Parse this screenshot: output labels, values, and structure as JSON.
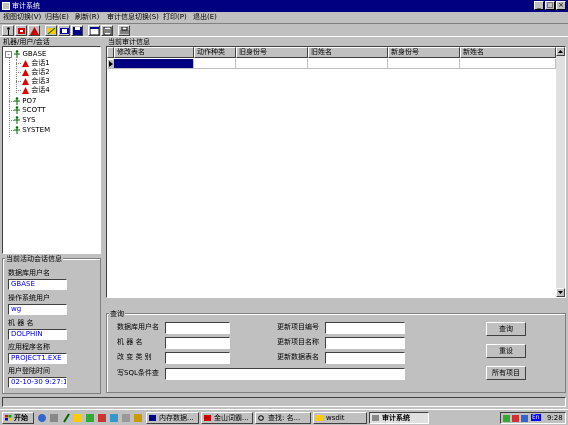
{
  "window": {
    "title": "审计系统"
  },
  "menu": [
    "视图切换(V)",
    "归档(E)",
    "刷新(R)",
    "审计信息切换(S)",
    "打印(P)",
    "退出(E)"
  ],
  "tree": {
    "title": "机器/用户/会话",
    "root": "GBASE",
    "sessions": [
      "会话1",
      "会话2",
      "会话3",
      "会话4"
    ],
    "users": [
      "PO7",
      "SCOTT",
      "SYS",
      "SYSTEM"
    ]
  },
  "session_info": {
    "title": "当前活动会话信息",
    "fields": [
      {
        "label": "数据库用户名",
        "value": "GBASE"
      },
      {
        "label": "操作系统用户",
        "value": "wg"
      },
      {
        "label": "机 器 名",
        "value": "DOLPHIN"
      },
      {
        "label": "应用程序名称",
        "value": "PROJECT1.EXE"
      },
      {
        "label": "用户登陆时间",
        "value": "02-10-30 9:27:10"
      }
    ]
  },
  "audit": {
    "title": "当前审计信息",
    "columns": [
      "修改表名",
      "动作种类",
      "旧身份号",
      "旧姓名",
      "新身份号",
      "新姓名"
    ]
  },
  "query": {
    "title": "查询",
    "labels": {
      "db_user": "数据库用户名",
      "machine": "机 器 名",
      "change_type": "改 变 类 别",
      "update_no": "更新项目编号",
      "update_name": "更新项目名称",
      "update_table": "更新数据表名",
      "sql": "写SQL条件查"
    },
    "buttons": {
      "query": "查询",
      "reset": "重设",
      "all": "所有项目"
    }
  },
  "taskbar": {
    "start": "开始",
    "tasks": [
      "内存数据...",
      "金山词霸...",
      "查找: 名...",
      "wsdit",
      "审计系统"
    ],
    "time": "9:28",
    "ime": "En"
  },
  "colors": {
    "titlebar": "#000080",
    "face": "#c0c0c0",
    "selected_cell": "#000080",
    "field_text": "#0000ff"
  }
}
